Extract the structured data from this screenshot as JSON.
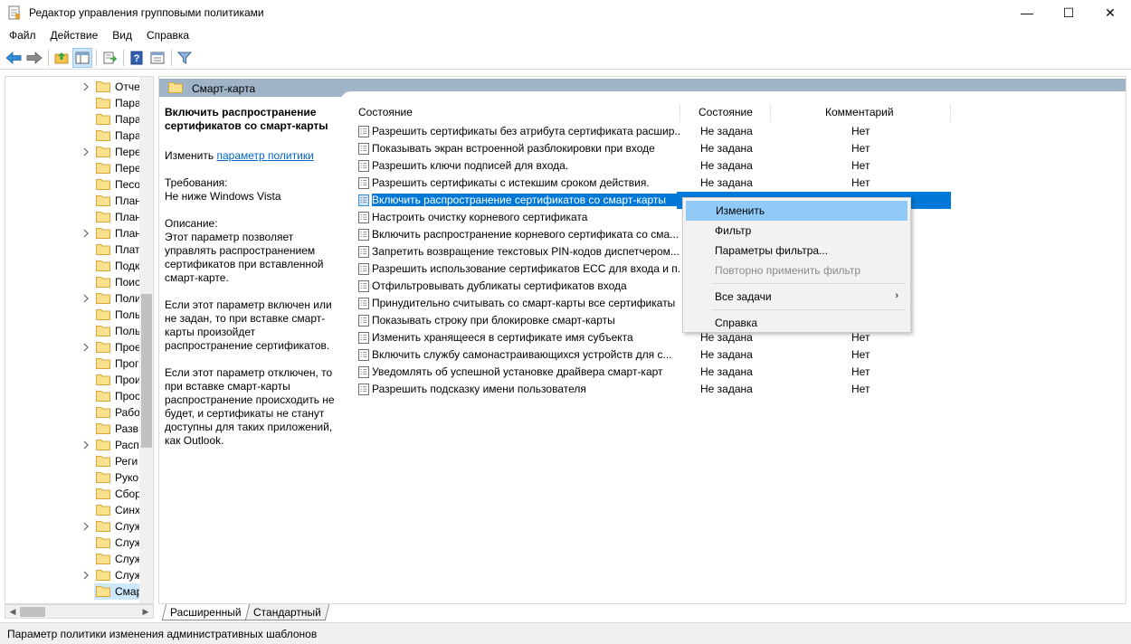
{
  "window": {
    "title": "Редактор управления групповыми политиками",
    "minimize": "—",
    "maximize": "☐",
    "close": "✕"
  },
  "menu": [
    "Файл",
    "Действие",
    "Вид",
    "Справка"
  ],
  "tree": {
    "items": [
      {
        "label": "Отче",
        "expandable": true
      },
      {
        "label": "Пара",
        "expandable": false
      },
      {
        "label": "Пара",
        "expandable": false
      },
      {
        "label": "Пара",
        "expandable": false
      },
      {
        "label": "Пере",
        "expandable": true
      },
      {
        "label": "Пере",
        "expandable": false
      },
      {
        "label": "Песо",
        "expandable": false
      },
      {
        "label": "План",
        "expandable": false
      },
      {
        "label": "План",
        "expandable": false
      },
      {
        "label": "План",
        "expandable": true
      },
      {
        "label": "Плат",
        "expandable": false
      },
      {
        "label": "Подк",
        "expandable": false
      },
      {
        "label": "Поис",
        "expandable": false
      },
      {
        "label": "Поли",
        "expandable": true
      },
      {
        "label": "Поль",
        "expandable": false
      },
      {
        "label": "Поль",
        "expandable": false
      },
      {
        "label": "Прое",
        "expandable": true
      },
      {
        "label": "Прог",
        "expandable": false
      },
      {
        "label": "Прои",
        "expandable": false
      },
      {
        "label": "Прос",
        "expandable": false
      },
      {
        "label": "Рабо",
        "expandable": false
      },
      {
        "label": "Разв",
        "expandable": false
      },
      {
        "label": "Расп",
        "expandable": true
      },
      {
        "label": "Реги",
        "expandable": false
      },
      {
        "label": "Руко",
        "expandable": false
      },
      {
        "label": "Сбор",
        "expandable": false
      },
      {
        "label": "Синх",
        "expandable": false
      },
      {
        "label": "Служ",
        "expandable": true
      },
      {
        "label": "Служ",
        "expandable": false
      },
      {
        "label": "Служ",
        "expandable": false
      },
      {
        "label": "Служ",
        "expandable": true
      },
      {
        "label": "Смар",
        "expandable": false,
        "selected": true
      }
    ]
  },
  "pane": {
    "header": "Смарт-карта",
    "desc": {
      "title": "Включить распространение сертификатов со смарт-карты",
      "edit_prefix": "Изменить ",
      "edit_link": "параметр политики",
      "requirements_label": "Требования:",
      "requirements_value": "Не ниже Windows Vista",
      "description_label": "Описание:",
      "p1": "Этот параметр позволяет управлять распространением сертификатов при вставленной смарт-карте.",
      "p2": "Если этот параметр включен или не задан, то при вставке смарт-карты произойдет распространение сертификатов.",
      "p3": "Если этот параметр отключен, то при вставке смарт-карты распространение происходить не будет, и сертификаты не станут доступны для таких приложений, как Outlook."
    },
    "columns": {
      "name": "Состояние",
      "state": "Состояние",
      "comment": "Комментарий"
    },
    "rows": [
      {
        "name": "Разрешить сертификаты без атрибута сертификата расшир...",
        "state": "Не задана",
        "comment": "Нет"
      },
      {
        "name": "Показывать экран встроенной разблокировки при входе",
        "state": "Не задана",
        "comment": "Нет"
      },
      {
        "name": "Разрешить ключи подписей для входа.",
        "state": "Не задана",
        "comment": "Нет"
      },
      {
        "name": "Разрешить сертификаты с истекшим сроком действия.",
        "state": "Не задана",
        "comment": "Нет"
      },
      {
        "name": "Включить распространение сертификатов со смарт-карты",
        "state": "",
        "comment": "",
        "selected": true
      },
      {
        "name": "Настроить очистку корневого сертификата",
        "state": "",
        "comment": ""
      },
      {
        "name": "Включить распространение корневого сертификата со сма...",
        "state": "",
        "comment": ""
      },
      {
        "name": "Запретить возвращение текстовых PIN-кодов диспетчером...",
        "state": "",
        "comment": ""
      },
      {
        "name": "Разрешить использование сертификатов ECC для входа и п...",
        "state": "",
        "comment": ""
      },
      {
        "name": "Отфильтровывать дубликаты сертификатов входа",
        "state": "",
        "comment": ""
      },
      {
        "name": "Принудительно считывать со смарт-карты все сертификаты",
        "state": "",
        "comment": ""
      },
      {
        "name": "Показывать строку при блокировке смарт-карты",
        "state": "",
        "comment": ""
      },
      {
        "name": "Изменить хранящееся в сертификате имя субъекта",
        "state": "Не задана",
        "comment": "Нет"
      },
      {
        "name": "Включить службу самонастраивающихся устройств для с...",
        "state": "Не задана",
        "comment": "Нет"
      },
      {
        "name": "Уведомлять об успешной установке драйвера смарт-карт",
        "state": "Не задана",
        "comment": "Нет"
      },
      {
        "name": "Разрешить подсказку имени пользователя",
        "state": "Не задана",
        "comment": "Нет"
      }
    ]
  },
  "context_menu": {
    "edit": "Изменить",
    "filter": "Фильтр",
    "filter_options": "Параметры фильтра...",
    "reapply_filter": "Повторно применить фильтр",
    "all_tasks": "Все задачи",
    "all_tasks_arrow": "›",
    "help": "Справка"
  },
  "tabs": {
    "extended": "Расширенный",
    "standard": "Стандартный"
  },
  "status": "Параметр политики изменения административных шаблонов"
}
